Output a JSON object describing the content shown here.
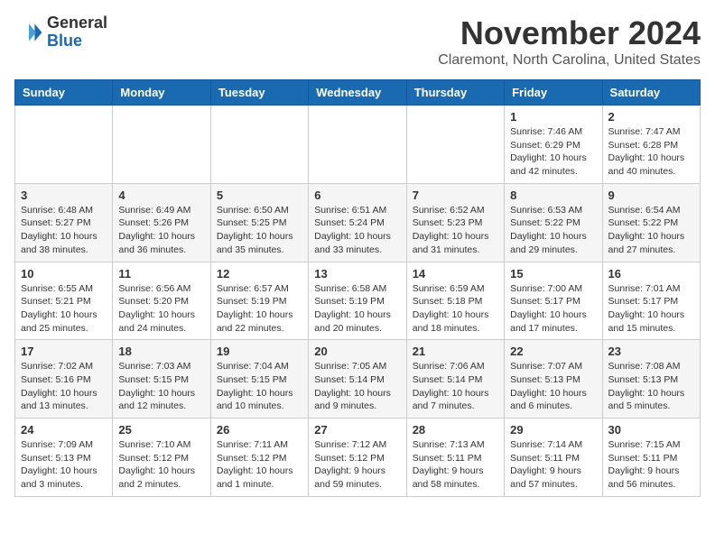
{
  "logo": {
    "general": "General",
    "blue": "Blue"
  },
  "title": "November 2024",
  "subtitle": "Claremont, North Carolina, United States",
  "weekdays": [
    "Sunday",
    "Monday",
    "Tuesday",
    "Wednesday",
    "Thursday",
    "Friday",
    "Saturday"
  ],
  "weeks": [
    [
      {
        "day": "",
        "info": ""
      },
      {
        "day": "",
        "info": ""
      },
      {
        "day": "",
        "info": ""
      },
      {
        "day": "",
        "info": ""
      },
      {
        "day": "",
        "info": ""
      },
      {
        "day": "1",
        "info": "Sunrise: 7:46 AM\nSunset: 6:29 PM\nDaylight: 10 hours\nand 42 minutes."
      },
      {
        "day": "2",
        "info": "Sunrise: 7:47 AM\nSunset: 6:28 PM\nDaylight: 10 hours\nand 40 minutes."
      }
    ],
    [
      {
        "day": "3",
        "info": "Sunrise: 6:48 AM\nSunset: 5:27 PM\nDaylight: 10 hours\nand 38 minutes."
      },
      {
        "day": "4",
        "info": "Sunrise: 6:49 AM\nSunset: 5:26 PM\nDaylight: 10 hours\nand 36 minutes."
      },
      {
        "day": "5",
        "info": "Sunrise: 6:50 AM\nSunset: 5:25 PM\nDaylight: 10 hours\nand 35 minutes."
      },
      {
        "day": "6",
        "info": "Sunrise: 6:51 AM\nSunset: 5:24 PM\nDaylight: 10 hours\nand 33 minutes."
      },
      {
        "day": "7",
        "info": "Sunrise: 6:52 AM\nSunset: 5:23 PM\nDaylight: 10 hours\nand 31 minutes."
      },
      {
        "day": "8",
        "info": "Sunrise: 6:53 AM\nSunset: 5:22 PM\nDaylight: 10 hours\nand 29 minutes."
      },
      {
        "day": "9",
        "info": "Sunrise: 6:54 AM\nSunset: 5:22 PM\nDaylight: 10 hours\nand 27 minutes."
      }
    ],
    [
      {
        "day": "10",
        "info": "Sunrise: 6:55 AM\nSunset: 5:21 PM\nDaylight: 10 hours\nand 25 minutes."
      },
      {
        "day": "11",
        "info": "Sunrise: 6:56 AM\nSunset: 5:20 PM\nDaylight: 10 hours\nand 24 minutes."
      },
      {
        "day": "12",
        "info": "Sunrise: 6:57 AM\nSunset: 5:19 PM\nDaylight: 10 hours\nand 22 minutes."
      },
      {
        "day": "13",
        "info": "Sunrise: 6:58 AM\nSunset: 5:19 PM\nDaylight: 10 hours\nand 20 minutes."
      },
      {
        "day": "14",
        "info": "Sunrise: 6:59 AM\nSunset: 5:18 PM\nDaylight: 10 hours\nand 18 minutes."
      },
      {
        "day": "15",
        "info": "Sunrise: 7:00 AM\nSunset: 5:17 PM\nDaylight: 10 hours\nand 17 minutes."
      },
      {
        "day": "16",
        "info": "Sunrise: 7:01 AM\nSunset: 5:17 PM\nDaylight: 10 hours\nand 15 minutes."
      }
    ],
    [
      {
        "day": "17",
        "info": "Sunrise: 7:02 AM\nSunset: 5:16 PM\nDaylight: 10 hours\nand 13 minutes."
      },
      {
        "day": "18",
        "info": "Sunrise: 7:03 AM\nSunset: 5:15 PM\nDaylight: 10 hours\nand 12 minutes."
      },
      {
        "day": "19",
        "info": "Sunrise: 7:04 AM\nSunset: 5:15 PM\nDaylight: 10 hours\nand 10 minutes."
      },
      {
        "day": "20",
        "info": "Sunrise: 7:05 AM\nSunset: 5:14 PM\nDaylight: 10 hours\nand 9 minutes."
      },
      {
        "day": "21",
        "info": "Sunrise: 7:06 AM\nSunset: 5:14 PM\nDaylight: 10 hours\nand 7 minutes."
      },
      {
        "day": "22",
        "info": "Sunrise: 7:07 AM\nSunset: 5:13 PM\nDaylight: 10 hours\nand 6 minutes."
      },
      {
        "day": "23",
        "info": "Sunrise: 7:08 AM\nSunset: 5:13 PM\nDaylight: 10 hours\nand 5 minutes."
      }
    ],
    [
      {
        "day": "24",
        "info": "Sunrise: 7:09 AM\nSunset: 5:13 PM\nDaylight: 10 hours\nand 3 minutes."
      },
      {
        "day": "25",
        "info": "Sunrise: 7:10 AM\nSunset: 5:12 PM\nDaylight: 10 hours\nand 2 minutes."
      },
      {
        "day": "26",
        "info": "Sunrise: 7:11 AM\nSunset: 5:12 PM\nDaylight: 10 hours\nand 1 minute."
      },
      {
        "day": "27",
        "info": "Sunrise: 7:12 AM\nSunset: 5:12 PM\nDaylight: 9 hours\nand 59 minutes."
      },
      {
        "day": "28",
        "info": "Sunrise: 7:13 AM\nSunset: 5:11 PM\nDaylight: 9 hours\nand 58 minutes."
      },
      {
        "day": "29",
        "info": "Sunrise: 7:14 AM\nSunset: 5:11 PM\nDaylight: 9 hours\nand 57 minutes."
      },
      {
        "day": "30",
        "info": "Sunrise: 7:15 AM\nSunset: 5:11 PM\nDaylight: 9 hours\nand 56 minutes."
      }
    ]
  ]
}
